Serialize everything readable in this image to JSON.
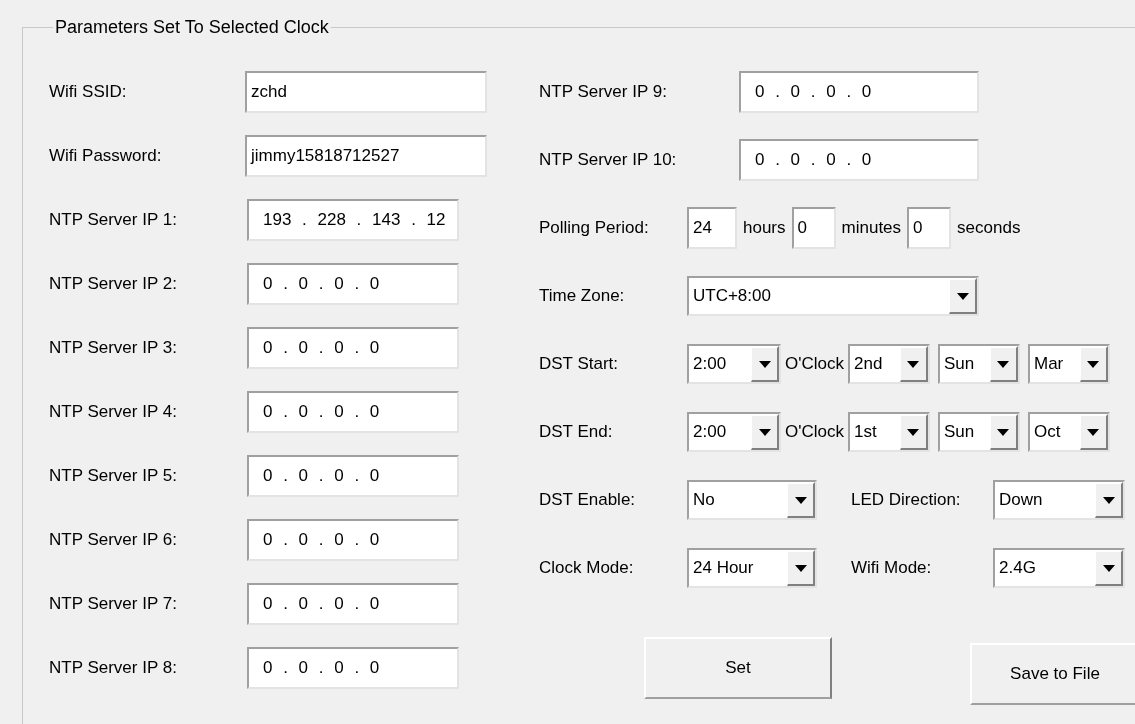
{
  "group": {
    "title": "Parameters Set To Selected Clock"
  },
  "left_fields": [
    {
      "label": "Wifi SSID:",
      "value": "zchd",
      "kind": "text"
    },
    {
      "label": "Wifi Password:",
      "value": "jimmy15818712527",
      "kind": "text"
    },
    {
      "label": "NTP Server IP 1:",
      "value": "193 . 228 . 143 . 12",
      "kind": "ip"
    },
    {
      "label": "NTP Server IP 2:",
      "value": "0 . 0 . 0 . 0",
      "kind": "ip"
    },
    {
      "label": "NTP Server IP 3:",
      "value": "0 . 0 . 0 . 0",
      "kind": "ip"
    },
    {
      "label": "NTP Server IP 4:",
      "value": "0 . 0 . 0 . 0",
      "kind": "ip"
    },
    {
      "label": "NTP Server IP 5:",
      "value": "0 . 0 . 0 . 0",
      "kind": "ip"
    },
    {
      "label": "NTP Server IP 6:",
      "value": "0 . 0 . 0 . 0",
      "kind": "ip"
    },
    {
      "label": "NTP Server IP 7:",
      "value": "0 . 0 . 0 . 0",
      "kind": "ip"
    },
    {
      "label": "NTP Server IP 8:",
      "value": "0 . 0 . 0 . 0",
      "kind": "ip"
    }
  ],
  "right_rows": [
    {
      "kind": "ip",
      "label": "NTP Server IP 9:",
      "value": "0 . 0 . 0 . 0"
    },
    {
      "kind": "ip",
      "label": "NTP Server IP 10:",
      "value": "0 . 0 . 0 . 0"
    },
    {
      "kind": "polling",
      "label": "Polling Period:",
      "parts": [
        {
          "value": "24",
          "unit": "hours"
        },
        {
          "value": "0",
          "unit": "minutes"
        },
        {
          "value": "0",
          "unit": "seconds"
        }
      ]
    },
    {
      "kind": "combo",
      "label": "Time Zone:",
      "value": "UTC+8:00"
    },
    {
      "kind": "dst",
      "label": "DST Start:",
      "hour": "2:00",
      "suffix": "O'Clock",
      "combos": [
        "2nd",
        "Sun",
        "Mar"
      ]
    },
    {
      "kind": "dst",
      "label": "DST End:",
      "hour": "2:00",
      "suffix": "O'Clock",
      "combos": [
        "1st",
        "Sun",
        "Oct"
      ]
    },
    {
      "kind": "pair",
      "items": [
        {
          "label": "DST Enable:",
          "value": "No"
        },
        {
          "label": "LED Direction:",
          "value": "Down"
        }
      ]
    },
    {
      "kind": "pair",
      "items": [
        {
          "label": "Clock Mode:",
          "value": "24 Hour"
        },
        {
          "label": "Wifi Mode:",
          "value": "2.4G"
        }
      ]
    }
  ],
  "buttons": [
    "Set",
    "Save to File"
  ]
}
